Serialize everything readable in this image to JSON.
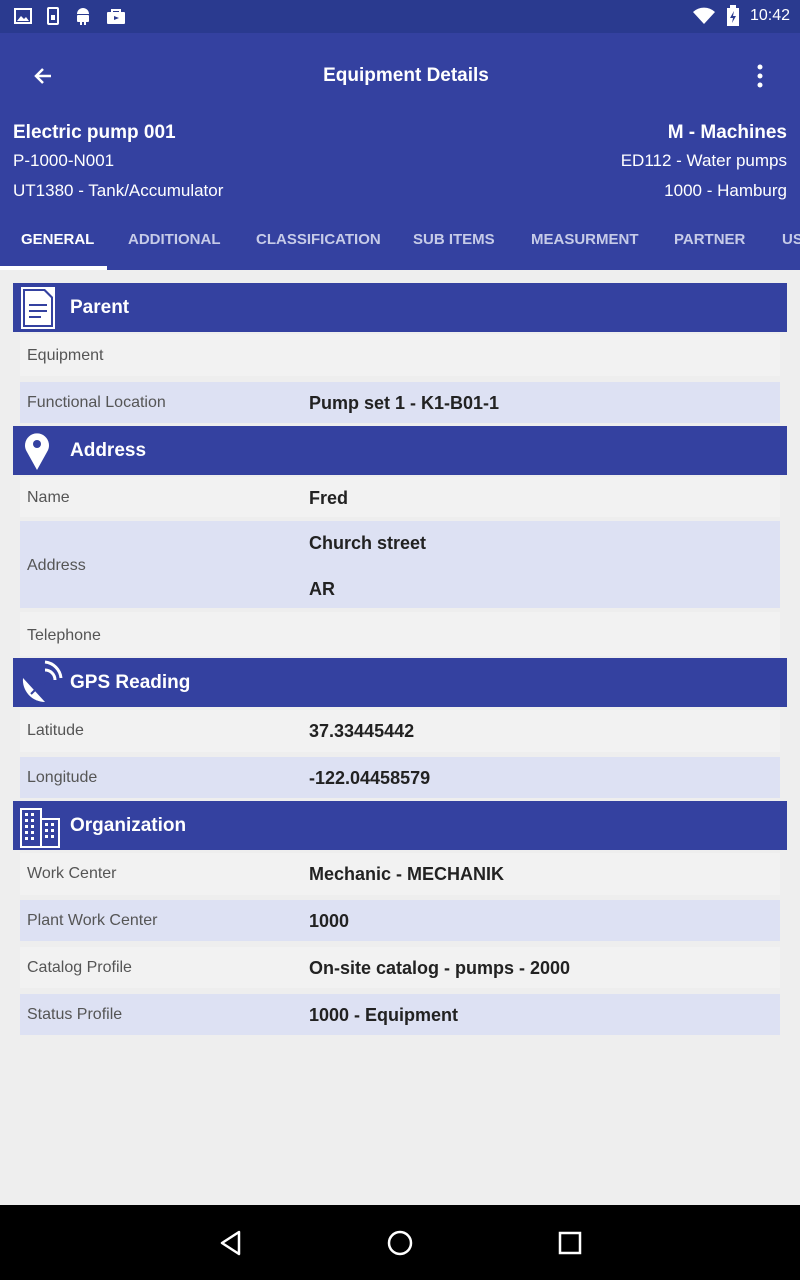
{
  "status_bar": {
    "time": "10:42",
    "icons": [
      "image-icon",
      "sim-icon",
      "android-icon",
      "shopping-bag-icon",
      "wifi-icon",
      "battery-icon"
    ]
  },
  "app_bar": {
    "title": "Equipment Details",
    "back_icon": "arrow-left-icon",
    "menu_icon": "more-vertical-icon",
    "color": "#3441a0"
  },
  "header": {
    "name": "Electric pump 001",
    "code": "P-1000-N001",
    "type": "UT1380 - Tank/Accumulator",
    "category": "M - Machines",
    "group": "ED112 - Water pumps",
    "plant": "1000 - Hamburg"
  },
  "tabs": [
    {
      "label": "GENERAL",
      "active": true
    },
    {
      "label": "ADDITIONAL",
      "active": false
    },
    {
      "label": "CLASSIFICATION",
      "active": false
    },
    {
      "label": "SUB ITEMS",
      "active": false
    },
    {
      "label": "MEASURMENT",
      "active": false
    },
    {
      "label": "PARTNER",
      "active": false
    },
    {
      "label": "US",
      "active": false
    }
  ],
  "sections": {
    "parent": {
      "title": "Parent",
      "icon": "document-icon",
      "rows": [
        {
          "label": "Equipment",
          "value": ""
        },
        {
          "label": "Functional Location",
          "value": "Pump set 1 - K1-B01-1"
        }
      ]
    },
    "address": {
      "title": "Address",
      "icon": "location-pin-icon",
      "rows": [
        {
          "label": "Name",
          "value": "Fred"
        },
        {
          "label": "Address",
          "value": "Church street",
          "value2": "AR"
        },
        {
          "label": "Telephone",
          "value": ""
        }
      ]
    },
    "gps": {
      "title": "GPS Reading",
      "icon": "satellite-dish-icon",
      "rows": [
        {
          "label": "Latitude",
          "value": "37.33445442"
        },
        {
          "label": "Longitude",
          "value": "-122.04458579"
        }
      ]
    },
    "organization": {
      "title": "Organization",
      "icon": "building-icon",
      "rows": [
        {
          "label": "Work Center",
          "value": "Mechanic - MECHANIK"
        },
        {
          "label": "Plant Work Center",
          "value": "1000"
        },
        {
          "label": "Catalog Profile",
          "value": "On-site catalog - pumps - 2000"
        },
        {
          "label": "Status Profile",
          "value": "1000 - Equipment"
        }
      ]
    }
  },
  "nav_bar": {
    "icons": [
      "back-triangle-icon",
      "home-circle-icon",
      "recents-square-icon"
    ]
  }
}
